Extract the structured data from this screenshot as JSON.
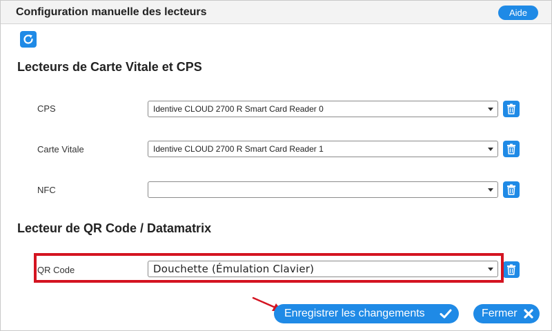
{
  "dialog": {
    "title": "Configuration manuelle des lecteurs",
    "help_label": "Aide"
  },
  "sections": {
    "vitale": {
      "title": "Lecteurs de Carte Vitale et CPS",
      "rows": [
        {
          "label": "CPS",
          "value": "Identive CLOUD 2700 R Smart Card Reader 0"
        },
        {
          "label": "Carte Vitale",
          "value": "Identive CLOUD 2700 R Smart Card Reader 1"
        },
        {
          "label": "NFC",
          "value": ""
        }
      ]
    },
    "qr": {
      "title": "Lecteur de QR Code / Datamatrix",
      "rows": [
        {
          "label": "QR Code",
          "value": "Douchette (Émulation Clavier)"
        }
      ]
    }
  },
  "footer": {
    "save_label": "Enregistrer les changements",
    "close_label": "Fermer"
  },
  "colors": {
    "accent": "#1f8ae6",
    "highlight": "#d41421"
  },
  "icons": {
    "refresh": "refresh-icon",
    "delete": "trash-icon",
    "check": "check-icon",
    "close": "close-icon",
    "annotation": "arrow-icon"
  }
}
